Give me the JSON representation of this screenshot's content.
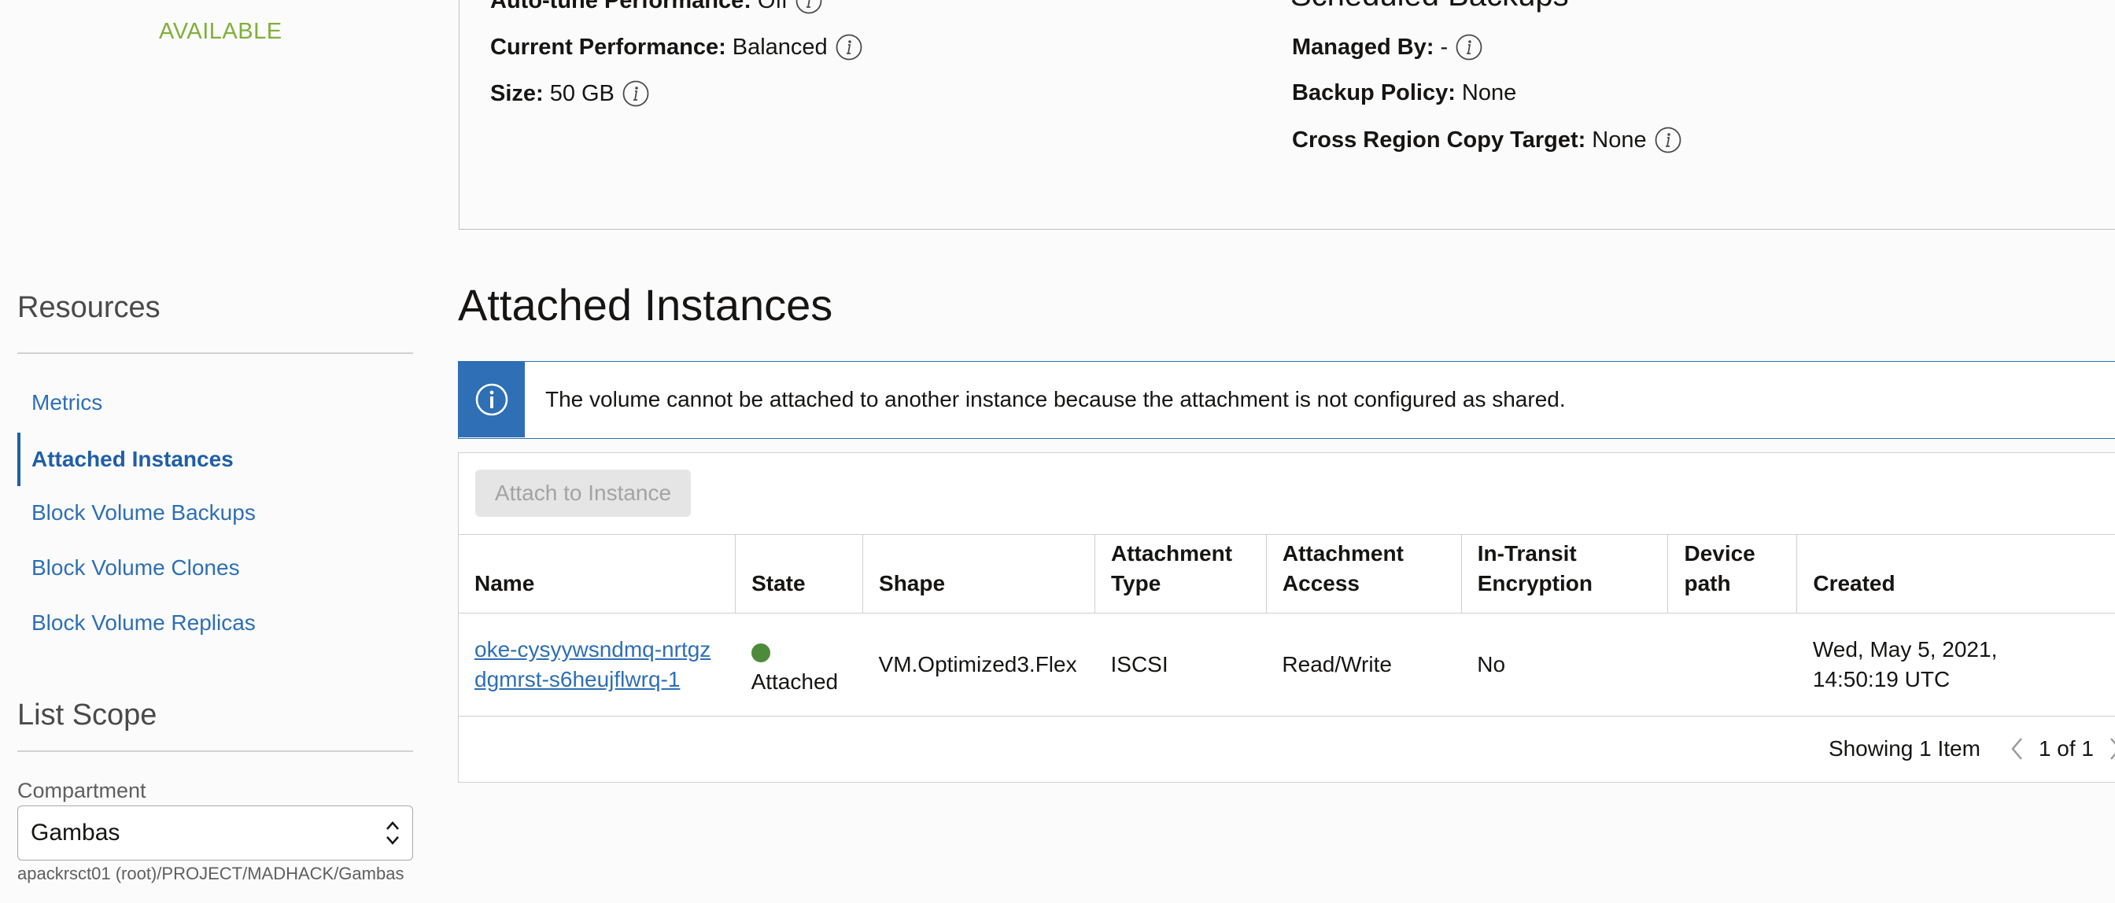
{
  "status": "AVAILABLE",
  "details": {
    "autotune_label": "Auto-tune Performance:",
    "autotune_value": "Off",
    "current_perf_label": "Current Performance:",
    "current_perf_value": "Balanced",
    "size_label": "Size:",
    "size_value": "50 GB",
    "right_heading": "Scheduled Backups",
    "managed_by_label": "Managed By:",
    "managed_by_value": "-",
    "backup_policy_label": "Backup Policy:",
    "backup_policy_value": "None",
    "cross_region_label": "Cross Region Copy Target:",
    "cross_region_value": "None"
  },
  "sidebar": {
    "resources_heading": "Resources",
    "items": [
      {
        "label": "Metrics"
      },
      {
        "label": "Attached Instances"
      },
      {
        "label": "Block Volume Backups"
      },
      {
        "label": "Block Volume Clones"
      },
      {
        "label": "Block Volume Replicas"
      }
    ],
    "list_scope_heading": "List Scope",
    "compartment_label": "Compartment",
    "compartment_value": "Gambas",
    "compartment_path": "apackrsct01 (root)/PROJECT/MADHACK/Gambas"
  },
  "main": {
    "title": "Attached Instances",
    "banner_text": "The volume cannot be attached to another instance because the attachment is not configured as shared.",
    "attach_button": "Attach to Instance",
    "columns": {
      "name": "Name",
      "state": "State",
      "shape": "Shape",
      "attachment_type": [
        "Attachment",
        "Type"
      ],
      "attachment_access": [
        "Attachment",
        "Access"
      ],
      "in_transit": [
        "In-Transit",
        "Encryption"
      ],
      "device_path": [
        "Device",
        "path"
      ],
      "created": "Created"
    },
    "rows": [
      {
        "name_line1": "oke-cysyywsndmq-nrtgz",
        "name_line2": "dgmrst-s6heujflwrq-1",
        "state": "Attached",
        "shape": "VM.Optimized3.Flex",
        "attachment_type": "ISCSI",
        "attachment_access": "Read/Write",
        "in_transit": "No",
        "device_path": "",
        "created_line1": "Wed, May 5, 2021,",
        "created_line2": "14:50:19 UTC"
      }
    ],
    "pager": {
      "showing": "Showing 1 Item",
      "page": "1 of 1"
    }
  },
  "colors": {
    "link": "#2e6fb5",
    "status_available": "#7fb03a",
    "state_attached": "#4c8b3a"
  }
}
